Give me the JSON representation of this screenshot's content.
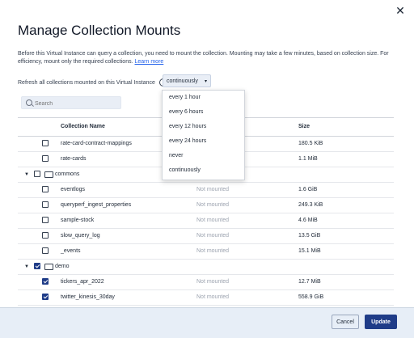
{
  "dialog": {
    "title": "Manage Collection Mounts",
    "close_symbol": "✕",
    "description": "Before this Virtual Instance can query a collection, you need to mount the collection. Mounting may take a few minutes, based on collection size. For efficiency, mount only the required collections.",
    "learn_more": "Learn more",
    "refresh_label": "Refresh all collections mounted on this Virtual Instance",
    "info_symbol": "i",
    "refresh_selected": "continuously",
    "caret_symbol": "▾",
    "refresh_options": [
      "every 1 hour",
      "every 6 hours",
      "every 12 hours",
      "every 24 hours",
      "never",
      "continuously"
    ]
  },
  "search": {
    "placeholder": "Search"
  },
  "table": {
    "headers": {
      "name": "Collection Name",
      "size": "Size"
    },
    "rows": [
      {
        "kind": "item",
        "name": "rate-card-contract-mappings",
        "status": "",
        "size": "180.5 KiB",
        "checked": false
      },
      {
        "kind": "item",
        "name": "rate-cards",
        "status": "",
        "size": "1.1 MiB",
        "checked": false
      },
      {
        "kind": "group",
        "name": "commons",
        "status": "",
        "size": "",
        "checked": false
      },
      {
        "kind": "item",
        "name": "eventlogs",
        "status": "Not mounted",
        "size": "1.6 GiB",
        "checked": false
      },
      {
        "kind": "item",
        "name": "queryperf_ingest_properties",
        "status": "Not mounted",
        "size": "249.3 KiB",
        "checked": false
      },
      {
        "kind": "item",
        "name": "sample-stock",
        "status": "Not mounted",
        "size": "4.6 MiB",
        "checked": false
      },
      {
        "kind": "item",
        "name": "slow_query_log",
        "status": "Not mounted",
        "size": "13.5 GiB",
        "checked": false
      },
      {
        "kind": "item",
        "name": "_events",
        "status": "Not mounted",
        "size": "15.1 MiB",
        "checked": false
      },
      {
        "kind": "group",
        "name": "demo",
        "status": "",
        "size": "",
        "checked": true
      },
      {
        "kind": "item",
        "name": "tickers_apr_2022",
        "status": "Not mounted",
        "size": "12.7 MiB",
        "checked": true
      },
      {
        "kind": "item",
        "name": "twitter_kinesis_30day",
        "status": "Not mounted",
        "size": "558.9 GiB",
        "checked": true
      }
    ],
    "group_toggle_symbol": "▼"
  },
  "footer": {
    "cancel_label": "Cancel",
    "update_label": "Update"
  },
  "colors": {
    "primary": "#1f3c88",
    "link": "#2563eb",
    "footer_bg": "#e7eef7"
  }
}
